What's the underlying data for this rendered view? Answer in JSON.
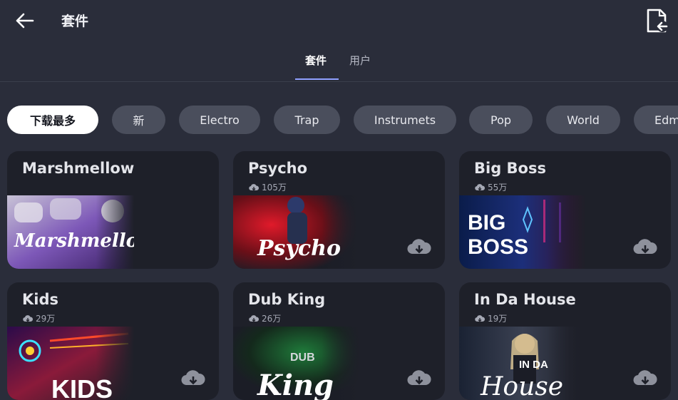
{
  "header": {
    "title": "套件"
  },
  "tabs": [
    {
      "label": "套件",
      "active": true
    },
    {
      "label": "用户",
      "active": false
    }
  ],
  "chips": [
    "下载最多",
    "新",
    "Electro",
    "Trap",
    "Instrumets",
    "Pop",
    "World",
    "Edm"
  ],
  "cards": [
    {
      "name": "Marshmellow",
      "downloads": "",
      "art_text": "Marshmellow"
    },
    {
      "name": "Psycho",
      "downloads": "105万",
      "art_text": "Psycho"
    },
    {
      "name": "Big Boss",
      "downloads": "55万",
      "art_text": "BIG BOSS"
    },
    {
      "name": "Kids",
      "downloads": "29万",
      "art_text": "KIDS"
    },
    {
      "name": "Dub King",
      "downloads": "26万",
      "art_text": "DUB King"
    },
    {
      "name": "In Da House",
      "downloads": "19万",
      "art_text": "IN DA House"
    }
  ],
  "colors": {
    "background": "#2a2d3a",
    "card": "#1e2029",
    "chip": "#4a4e5c",
    "accent": "#8fa0ff"
  }
}
